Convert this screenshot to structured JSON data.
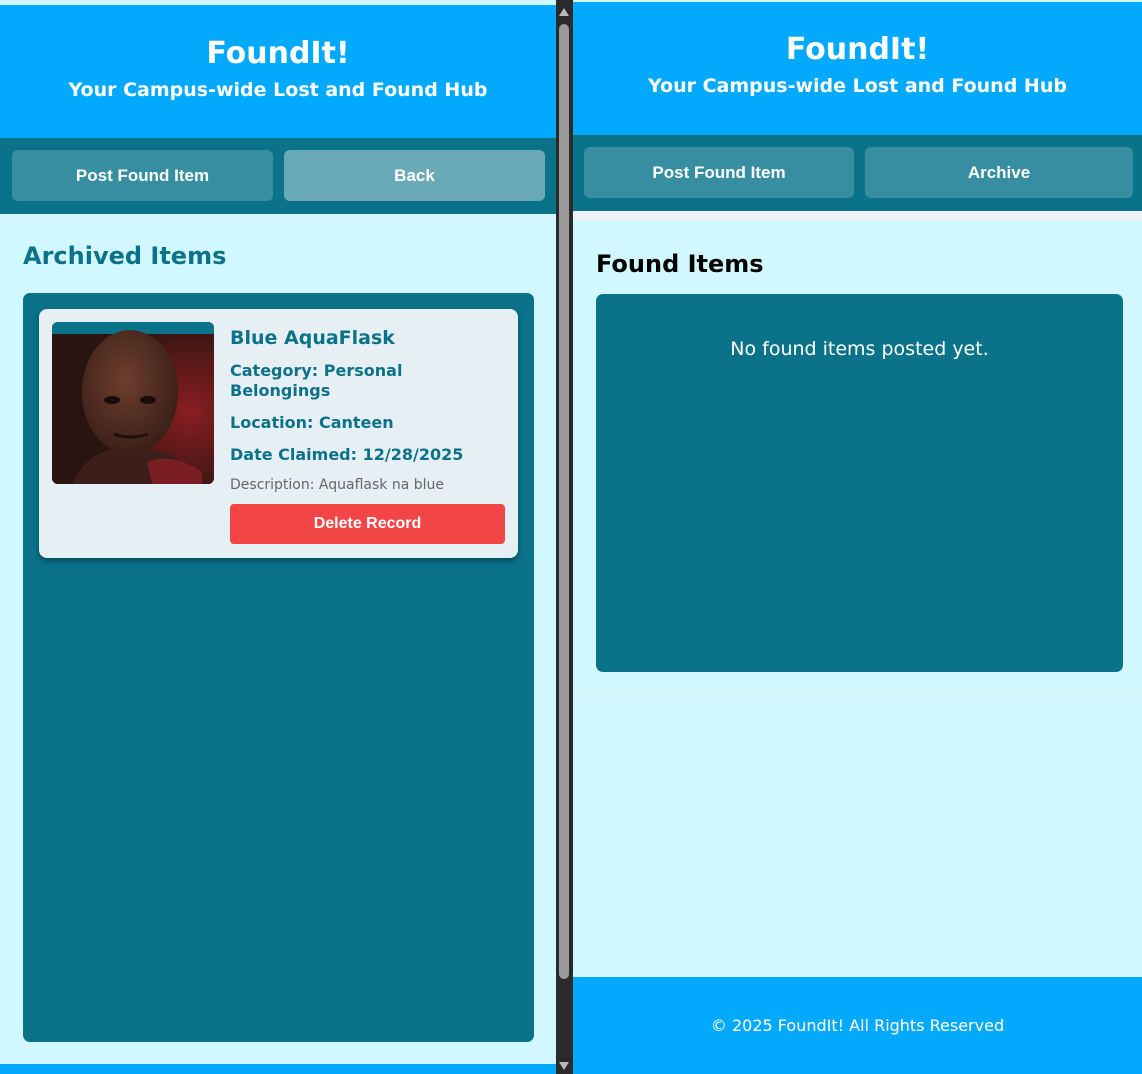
{
  "left": {
    "header": {
      "title": "FoundIt!",
      "subtitle": "Your Campus-wide Lost and Found Hub"
    },
    "nav": {
      "post_label": "Post Found Item",
      "back_label": "Back"
    },
    "section_title": "Archived Items",
    "items": [
      {
        "name": "Blue AquaFlask",
        "category": "Category: Personal Belongings",
        "location": "Location: Canteen",
        "date_claimed": "Date Claimed: 12/28/2025",
        "description": "Description: Aquaflask na blue",
        "delete_label": "Delete Record"
      }
    ]
  },
  "right": {
    "header": {
      "title": "FoundIt!",
      "subtitle": "Your Campus-wide Lost and Found Hub"
    },
    "nav": {
      "post_label": "Post Found Item",
      "archive_label": "Archive"
    },
    "section_title": "Found Items",
    "empty_message": "No found items posted yet.",
    "footer": "© 2025 FoundIt! All Rights Reserved"
  },
  "colors": {
    "header_blue": "#03a9fc",
    "teal_dark": "#0a7289",
    "button_teal": "#388ea1",
    "button_light": "#6aa9b7",
    "page_bg": "#d1f8fe",
    "delete_red": "#f24545"
  }
}
